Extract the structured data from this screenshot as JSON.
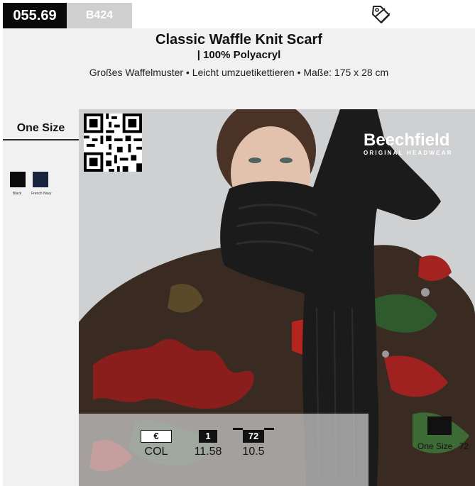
{
  "header": {
    "item_code": "055.69",
    "product_code": "B424",
    "title": "Classic Waffle Knit Scarf",
    "material": "| 100% Polyacryl",
    "features": "Großes Waffelmuster • Leicht umzuetikettieren • Maße: 175 x 28 cm"
  },
  "sidebar": {
    "size": "One Size",
    "colors": [
      {
        "name": "Black",
        "hex": "#0b0b0b"
      },
      {
        "name": "French Navy",
        "hex": "#1a2340"
      }
    ]
  },
  "brand": {
    "name": "Beechfield",
    "sub": "ORIGINAL HEADWEAR"
  },
  "pricing": {
    "currency": "€",
    "col_label": "COL",
    "tiers": [
      {
        "qty": "1",
        "price": "11.58"
      },
      {
        "qty": "72",
        "price": "10.5"
      }
    ],
    "size_label": "One Size",
    "size_qty": "72"
  },
  "icons": {
    "tag": "price-tag-icon",
    "qr": "qr-code-icon"
  }
}
